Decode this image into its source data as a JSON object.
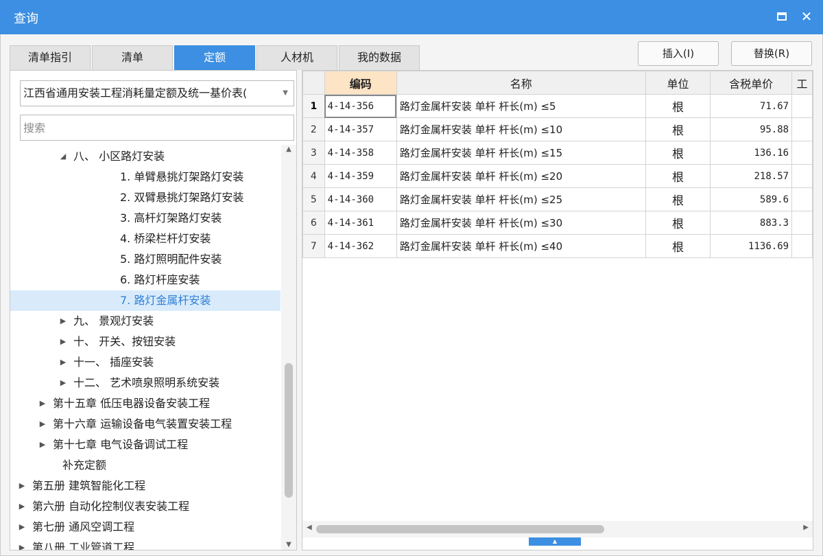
{
  "window": {
    "title": "查询",
    "maximize_icon": "maximize-icon",
    "close_glyph": "✕"
  },
  "tabs": [
    {
      "label": "清单指引",
      "active": false
    },
    {
      "label": "清单",
      "active": false
    },
    {
      "label": "定额",
      "active": true
    },
    {
      "label": "人材机",
      "active": false
    },
    {
      "label": "我的数据",
      "active": false
    }
  ],
  "toolbar": {
    "insert_label": "插入(I)",
    "replace_label": "替换(R)"
  },
  "left_panel": {
    "library_selected": "江西省通用安装工程消耗量定额及统一基价表(",
    "search_placeholder": "搜索",
    "tree": [
      {
        "label": "八、  小区路灯安装",
        "toggle": "◢",
        "expanded": true
      },
      {
        "label": "1. 单臂悬挑灯架路灯安装"
      },
      {
        "label": "2. 双臂悬挑灯架路灯安装"
      },
      {
        "label": "3. 高杆灯架路灯安装"
      },
      {
        "label": "4. 桥梁栏杆灯安装"
      },
      {
        "label": "5. 路灯照明配件安装"
      },
      {
        "label": "6. 路灯杆座安装"
      },
      {
        "label": "7. 路灯金属杆安装",
        "selected": true
      },
      {
        "label": "九、  景观灯安装",
        "toggle": "▶"
      },
      {
        "label": "十、  开关、按钮安装",
        "toggle": "▶"
      },
      {
        "label": "十一、  插座安装",
        "toggle": "▶"
      },
      {
        "label": "十二、  艺术喷泉照明系统安装",
        "toggle": "▶"
      },
      {
        "label": "第十五章 低压电器设备安装工程",
        "toggle": "▶"
      },
      {
        "label": "第十六章 运输设备电气装置安装工程",
        "toggle": "▶"
      },
      {
        "label": "第十七章 电气设备调试工程",
        "toggle": "▶"
      },
      {
        "label": "补充定额"
      },
      {
        "label": "第五册 建筑智能化工程",
        "toggle": "▶"
      },
      {
        "label": "第六册 自动化控制仪表安装工程",
        "toggle": "▶"
      },
      {
        "label": "第七册 通风空调工程",
        "toggle": "▶"
      },
      {
        "label": "第八册 工业管道工程",
        "toggle": "▶"
      }
    ]
  },
  "grid": {
    "headers": {
      "code": "编码",
      "name": "名称",
      "unit": "单位",
      "price": "含税单价",
      "extra": "工"
    },
    "rows": [
      {
        "num": "1",
        "code": "4-14-356",
        "name": "路灯金属杆安装 单杆 杆长(m) ≤5",
        "unit": "根",
        "price": "71.67"
      },
      {
        "num": "2",
        "code": "4-14-357",
        "name": "路灯金属杆安装 单杆 杆长(m) ≤10",
        "unit": "根",
        "price": "95.88"
      },
      {
        "num": "3",
        "code": "4-14-358",
        "name": "路灯金属杆安装 单杆 杆长(m) ≤15",
        "unit": "根",
        "price": "136.16"
      },
      {
        "num": "4",
        "code": "4-14-359",
        "name": "路灯金属杆安装 单杆 杆长(m) ≤20",
        "unit": "根",
        "price": "218.57"
      },
      {
        "num": "5",
        "code": "4-14-360",
        "name": "路灯金属杆安装 单杆 杆长(m) ≤25",
        "unit": "根",
        "price": "589.6"
      },
      {
        "num": "6",
        "code": "4-14-361",
        "name": "路灯金属杆安装 单杆 杆长(m) ≤30",
        "unit": "根",
        "price": "883.3"
      },
      {
        "num": "7",
        "code": "4-14-362",
        "name": "路灯金属杆安装 单杆 杆长(m) ≤40",
        "unit": "根",
        "price": "1136.69"
      }
    ]
  },
  "colors": {
    "accent": "#3c8fe2",
    "header_highlight": "#fce4c4",
    "selection": "#d9ebfb"
  }
}
